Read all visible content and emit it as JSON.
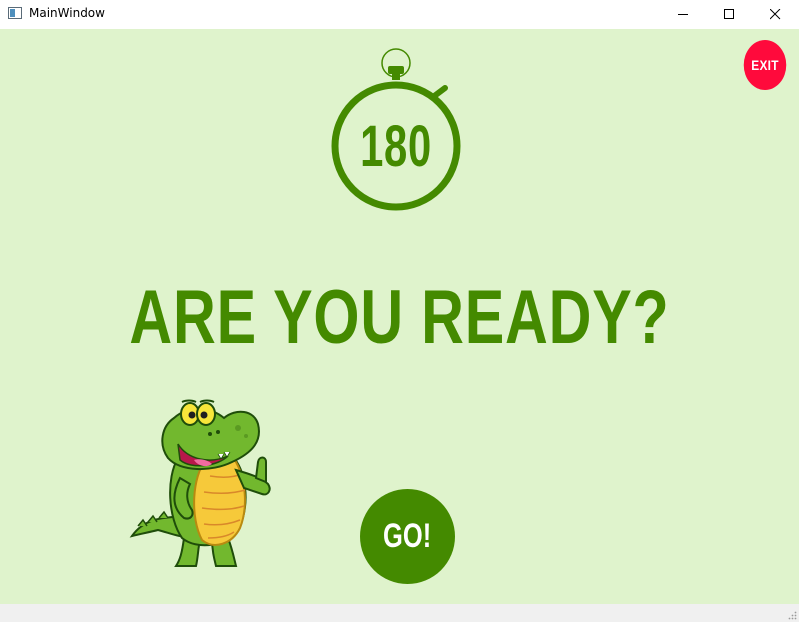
{
  "window": {
    "title": "MainWindow",
    "controls": [
      "minimize-icon",
      "maximize-icon",
      "close-icon"
    ]
  },
  "exit_button": {
    "label": "EXIT",
    "color": "#ff0a3c"
  },
  "timer": {
    "value": "180",
    "icon": "stopwatch-icon",
    "color": "#448a00"
  },
  "headline": "ARE YOU READY?",
  "go_button": {
    "label": "GO!",
    "color": "#448a00"
  },
  "mascot": {
    "icon": "crocodile-thumbs-up-illustration"
  },
  "colors": {
    "background": "#dff3cc",
    "accent": "#448a00",
    "exit": "#ff0a3c"
  }
}
